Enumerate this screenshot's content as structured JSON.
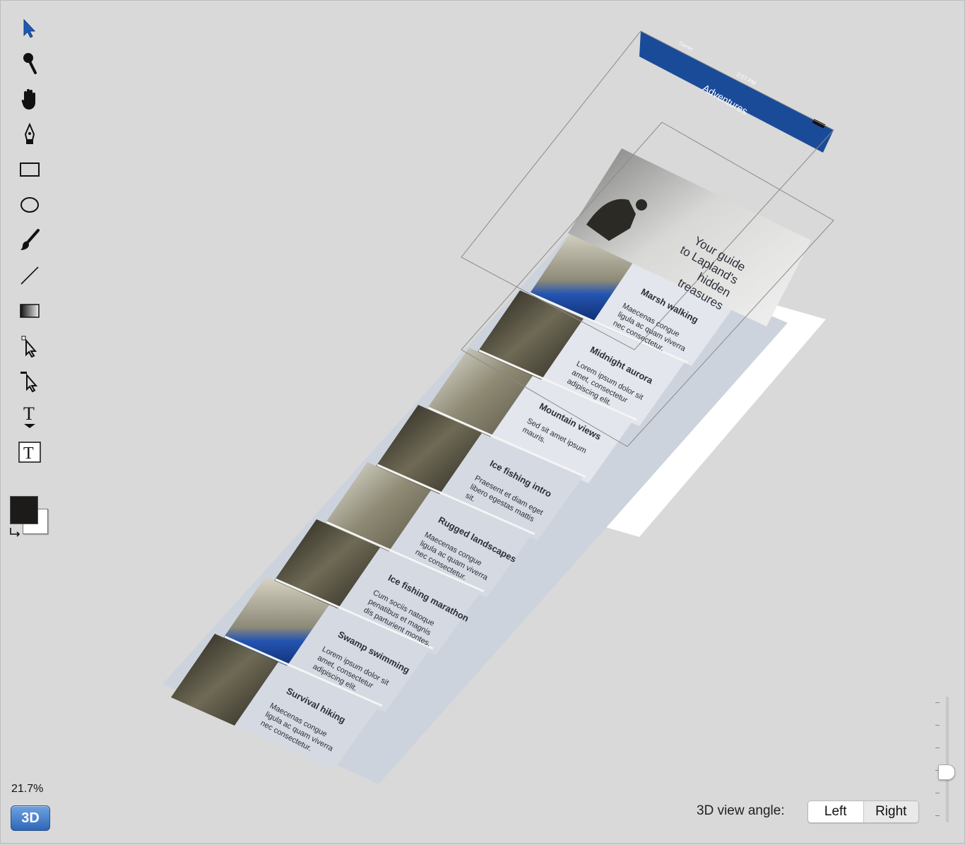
{
  "toolbar": {
    "tools": [
      {
        "name": "select-arrow-icon"
      },
      {
        "name": "zoom-icon"
      },
      {
        "name": "hand-icon"
      },
      {
        "name": "pen-icon"
      },
      {
        "name": "rectangle-icon"
      },
      {
        "name": "ellipse-icon"
      },
      {
        "name": "brush-icon"
      },
      {
        "name": "line-icon"
      },
      {
        "name": "gradient-icon"
      },
      {
        "name": "direct-select-icon"
      },
      {
        "name": "path-select-icon"
      },
      {
        "name": "text-path-icon"
      },
      {
        "name": "text-box-icon"
      }
    ],
    "foreground_color": "#1d1a1a",
    "background_color": "#ffffff",
    "zoom": "21.7%",
    "mode_button": "3D"
  },
  "app_preview": {
    "status_carrier": "Carrier",
    "status_time": "2:57 PM",
    "nav_title": "Adventures",
    "nav_color": "#1a4b99",
    "hero_text": "Your guide\nto Lapland's\nhidden\ntreasures",
    "cells": [
      {
        "title": "Marsh walking",
        "body": "Maecenas congue\nligula ac quam viverra\nnec consectetur."
      },
      {
        "title": "Midnight aurora",
        "body": "Lorem ipsum dolor sit\namet, consectetur\nadipiscing elit."
      },
      {
        "title": "Mountain views",
        "body": "Sed sit amet ipsum\nmauris."
      },
      {
        "title": "Ice fishing intro",
        "body": "Praesent et diam eget\nlibero egestas mattis\nsit."
      },
      {
        "title": "Rugged landscapes",
        "body": "Maecenas congue\nligula ac quam viverra\nnec consectetur."
      },
      {
        "title": "Ice fishing marathon",
        "body": "Cum sociis natoque\npenatibus et magnis\ndis parturient montes."
      },
      {
        "title": "Swamp swimming",
        "body": "Lorem ipsum dolor sit\namet, consectetur\nadipiscing elit."
      },
      {
        "title": "Survival hiking",
        "body": "Maecenas congue\nligula ac quam viverra\nnec consectetur."
      }
    ]
  },
  "view_controls": {
    "angle_label": "3D view angle:",
    "left_label": "Left",
    "right_label": "Right",
    "selected": "Left"
  }
}
